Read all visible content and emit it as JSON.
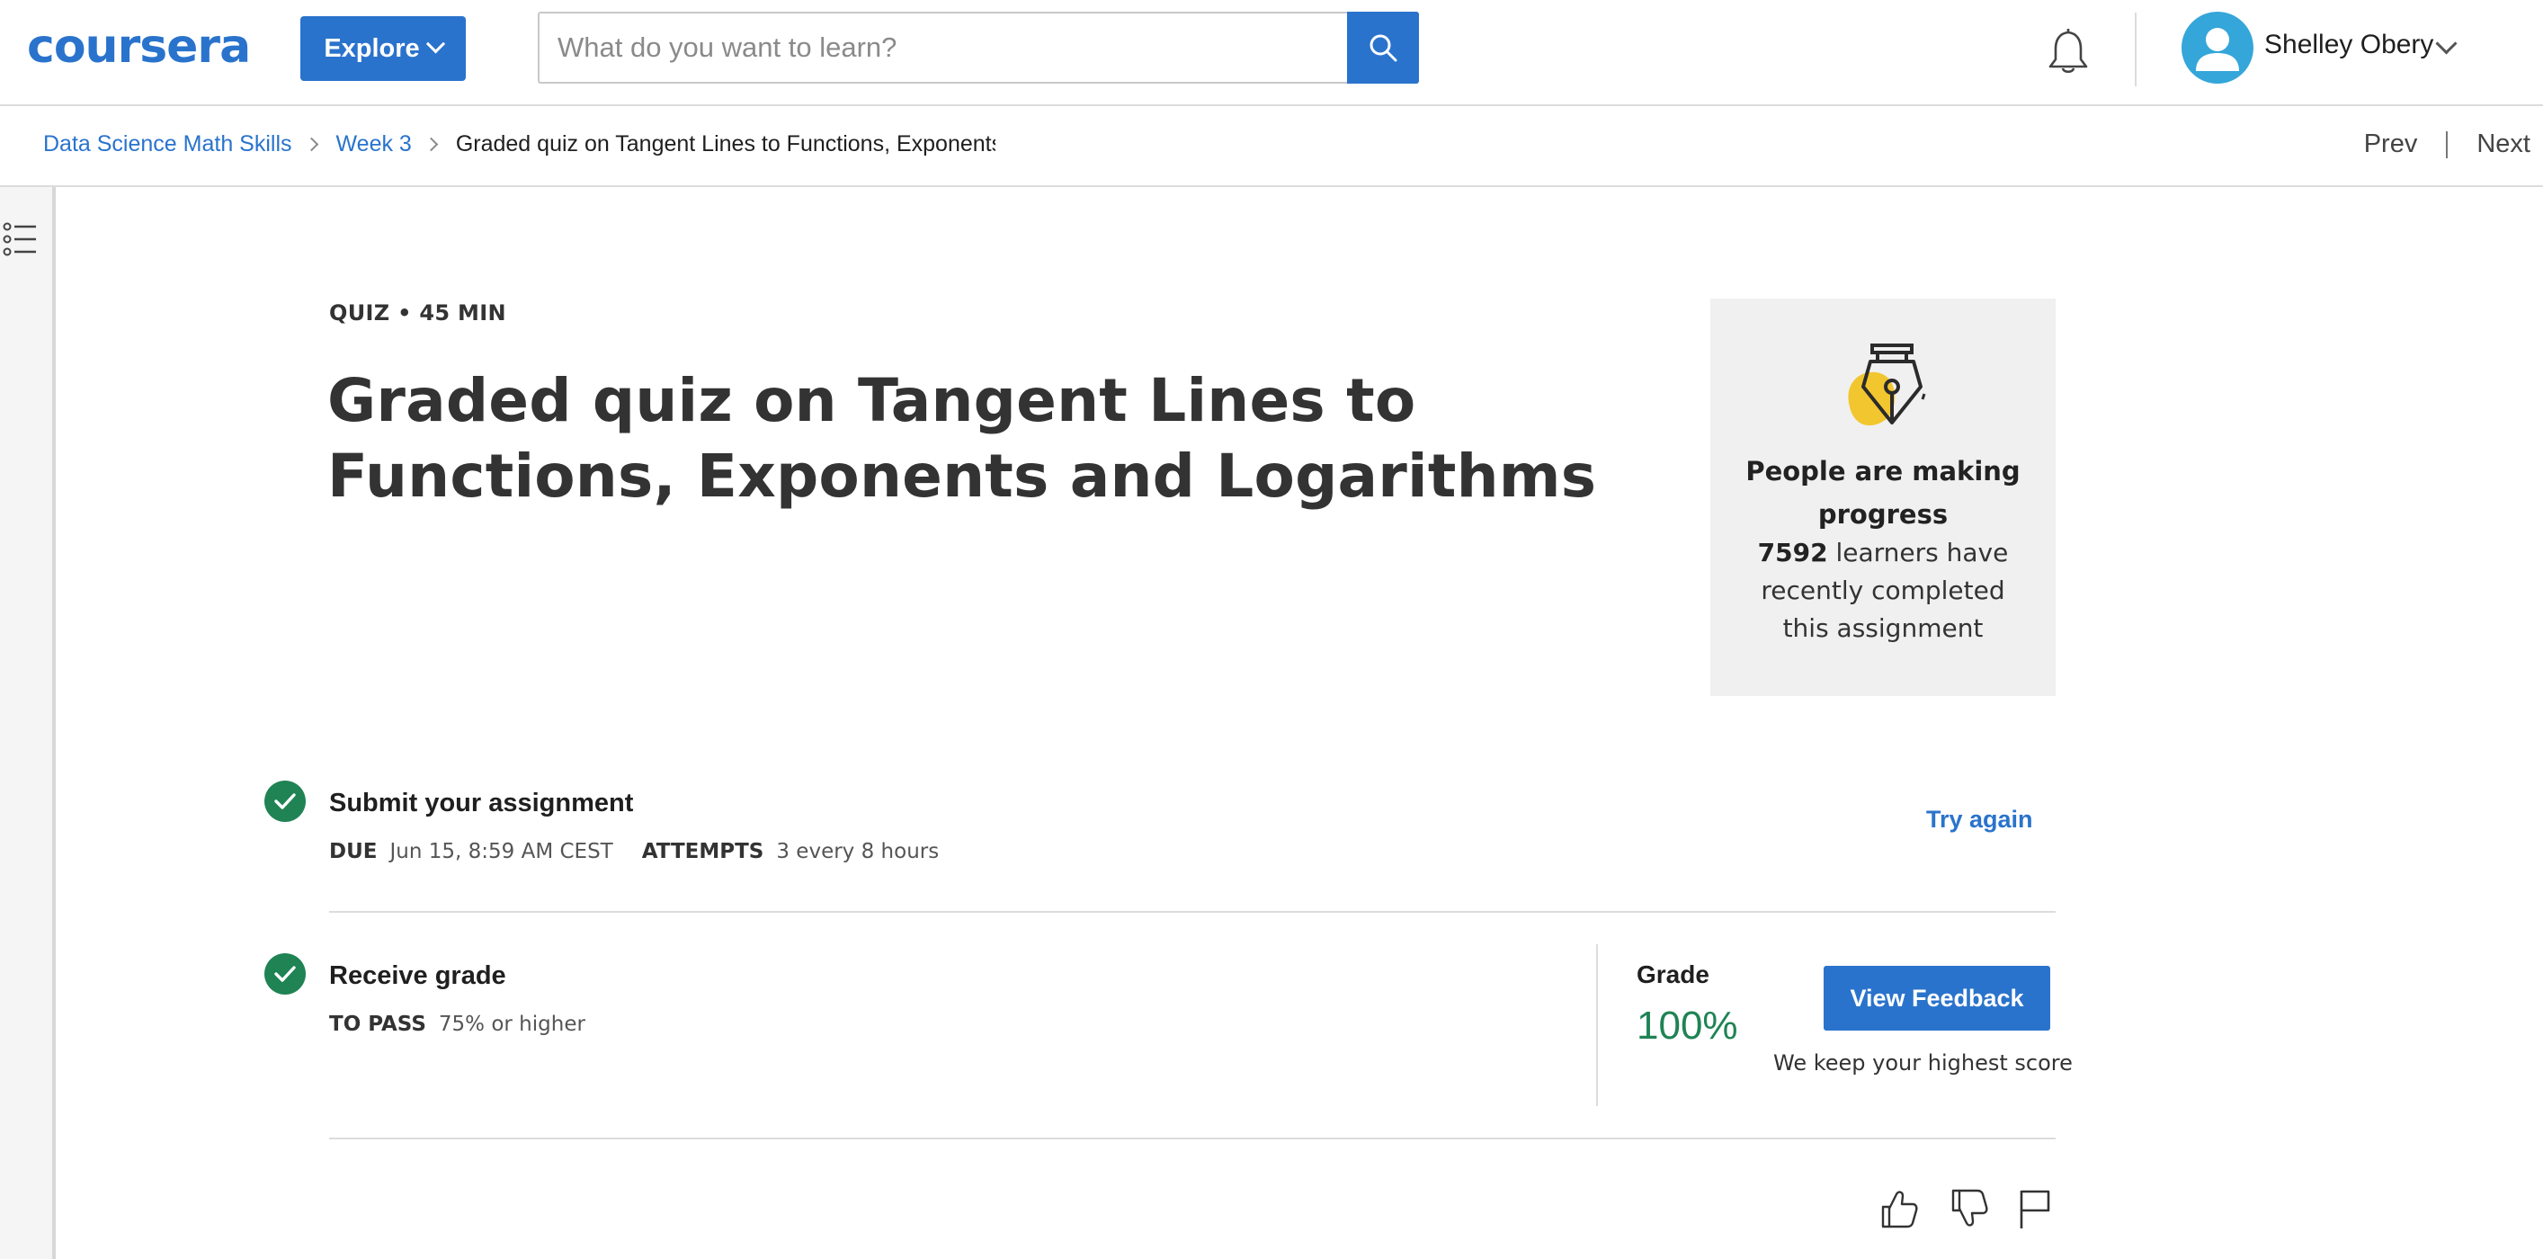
{
  "header": {
    "logo": "coursera",
    "explore_label": "Explore",
    "search_placeholder": "What do you want to learn?",
    "search_value": "",
    "user_name": "Shelley Obery"
  },
  "breadcrumb": {
    "items": [
      "Data Science Math Skills",
      "Week 3"
    ],
    "current": "Graded quiz on Tangent Lines to Functions, Exponents a"
  },
  "nav": {
    "prev": "Prev",
    "next": "Next"
  },
  "quiz": {
    "meta": "QUIZ • 45 MIN",
    "title": "Graded quiz on Tangent Lines to Functions, Exponents and Logarithms"
  },
  "progress_card": {
    "heading": "People are making progress",
    "count": "7592",
    "text": "learners have recently completed this assignment"
  },
  "submit": {
    "title": "Submit your assignment",
    "due_label": "DUE",
    "due_value": "Jun 15, 8:59 AM CEST",
    "attempts_label": "ATTEMPTS",
    "attempts_value": "3 every 8 hours",
    "try_again": "Try again"
  },
  "receive": {
    "title": "Receive grade",
    "pass_label": "TO PASS",
    "pass_value": "75% or higher",
    "grade_label": "Grade",
    "grade_value": "100%",
    "view_feedback": "View Feedback",
    "note": "We keep your highest score"
  },
  "colors": {
    "brand_blue": "#2a73cc",
    "success_green": "#1f8354",
    "avatar_blue": "#34a6d9",
    "card_gray": "#f0f0f0",
    "pen_yellow": "#f2c62f"
  },
  "icons": [
    "search-icon",
    "bell-icon",
    "avatar-icon",
    "chevron-down-icon",
    "course-outline-icon",
    "fountain-pen-icon",
    "check-icon",
    "thumbs-up-icon",
    "thumbs-down-icon",
    "flag-icon"
  ]
}
